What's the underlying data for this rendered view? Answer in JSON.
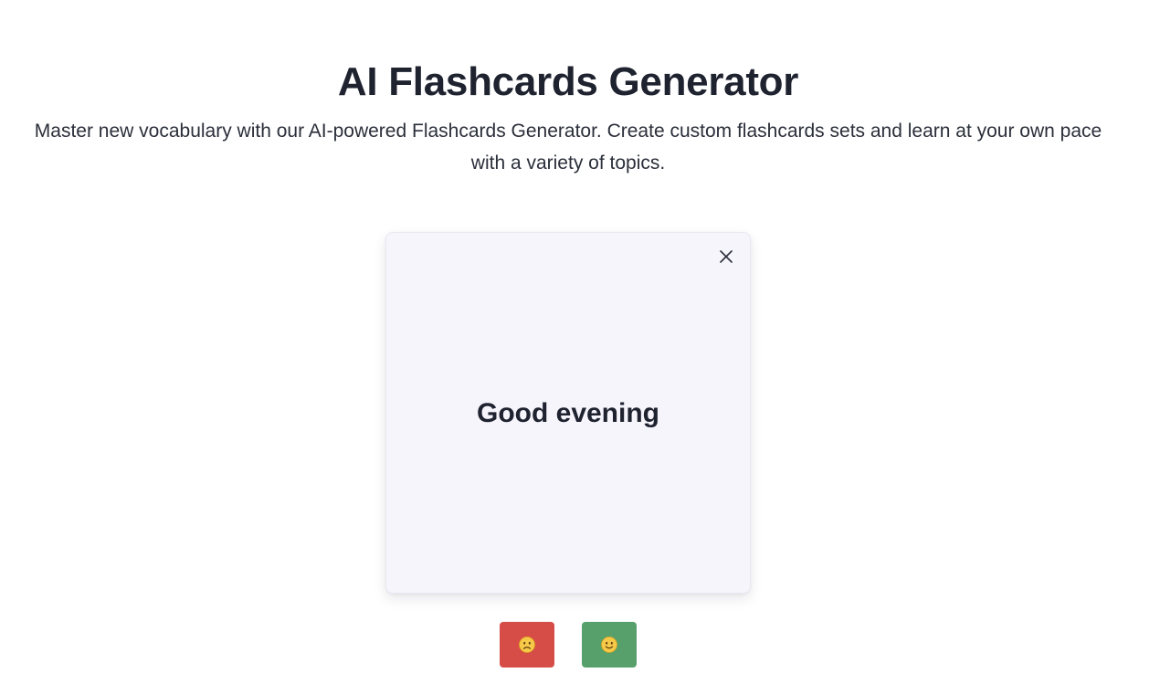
{
  "header": {
    "title": "AI Flashcards Generator",
    "subtitle": "Master new vocabulary with our AI-powered Flashcards Generator. Create custom flashcards sets and learn at your own pace with a variety of topics."
  },
  "flashcard": {
    "word": "Good evening",
    "close_icon": "close-icon"
  },
  "actions": {
    "wrong_icon": "frowning-face-icon",
    "right_icon": "smiling-face-icon",
    "wrong_color": "#d64d47",
    "right_color": "#57a06b"
  }
}
